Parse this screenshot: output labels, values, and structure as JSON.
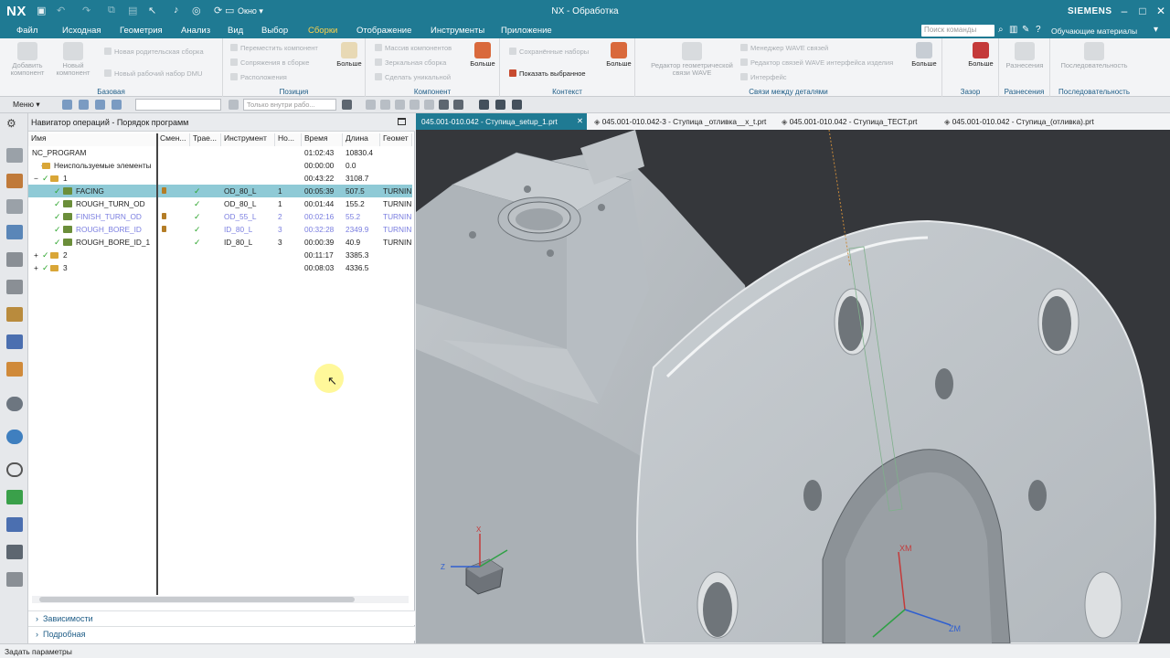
{
  "titlebar": {
    "logo": "NX",
    "window_label": "Окно ▾",
    "title": "NX - Обработка",
    "brand": "SIEMENS",
    "minimize": "–",
    "maximize": "□",
    "close": "✕"
  },
  "menubar": {
    "items": [
      "Файл",
      "Исходная",
      "Геометрия",
      "Анализ",
      "Вид",
      "Выбор",
      "Сборки",
      "Отображение",
      "Инструменты",
      "Приложение"
    ],
    "active": "Сборки",
    "search_placeholder": "Поиск команды",
    "learn": "Обучающие материалы"
  },
  "ribbon": {
    "base": {
      "label": "Базовая",
      "add_component": "Добавить компонент",
      "new_component": "Новый компонент",
      "new_parent": "Новая родительская сборка",
      "new_dmu": "Новый рабочий набор DMU"
    },
    "position": {
      "label": "Позиция",
      "move": "Переместить компонент",
      "constraints": "Сопряжения в сборке",
      "arrange": "Расположения",
      "more": "Больше"
    },
    "component": {
      "label": "Компонент",
      "array": "Массив компонентов",
      "mirror": "Зеркальная сборка",
      "unique": "Сделать уникальной",
      "more": "Больше"
    },
    "context": {
      "label": "Контекст",
      "saved_sets": "Сохранённые наборы",
      "show_selected": "Показать выбранное",
      "more": "Больше"
    },
    "links": {
      "label": "Связи между деталями",
      "editor": "Редактор геометрической связи WAVE",
      "wave_manager": "Менеджер WAVE связей",
      "wave_interface": "Редактор связей WAVE интерфейса изделия",
      "interface": "Интерфейс",
      "more": "Больше"
    },
    "gap": {
      "label": "Зазор",
      "more": "Больше"
    },
    "explode": {
      "label": "Разнесения",
      "button": "Разнесения"
    },
    "sequence": {
      "label": "Последовательность",
      "button": "Последовательность"
    }
  },
  "toolbar": {
    "menu": "Меню ▾",
    "filter_combo": "",
    "scope_combo": "Только внутри рабо..."
  },
  "navigator": {
    "title": "Навигатор операций - Порядок программ",
    "columns": [
      "Имя",
      "Смен...",
      "Трае...",
      "Инструмент",
      "Но...",
      "Время",
      "Длина",
      "Геомет"
    ],
    "rows": [
      {
        "name": "NC_PROGRAM",
        "tool": "",
        "num": "",
        "time": "01:02:43",
        "length": "10830.4",
        "geom": ""
      },
      {
        "name": "Неиспользуемые элементы",
        "tool": "",
        "num": "",
        "time": "00:00:00",
        "length": "0.0",
        "geom": ""
      },
      {
        "name": "1",
        "tool": "",
        "num": "",
        "time": "00:43:22",
        "length": "3108.7",
        "geom": ""
      },
      {
        "name": "FACING",
        "tool": "OD_80_L",
        "num": "1",
        "time": "00:05:39",
        "length": "507.5",
        "geom": "TURNIN"
      },
      {
        "name": "ROUGH_TURN_OD",
        "tool": "OD_80_L",
        "num": "1",
        "time": "00:01:44",
        "length": "155.2",
        "geom": "TURNIN"
      },
      {
        "name": "FINISH_TURN_OD",
        "tool": "OD_55_L",
        "num": "2",
        "time": "00:02:16",
        "length": "55.2",
        "geom": "TURNIN"
      },
      {
        "name": "ROUGH_BORE_ID",
        "tool": "ID_80_L",
        "num": "3",
        "time": "00:32:28",
        "length": "2349.9",
        "geom": "TURNIN"
      },
      {
        "name": "ROUGH_BORE_ID_1",
        "tool": "ID_80_L",
        "num": "3",
        "time": "00:00:39",
        "length": "40.9",
        "geom": "TURNIN"
      },
      {
        "name": "2",
        "tool": "",
        "num": "",
        "time": "00:11:17",
        "length": "3385.3",
        "geom": ""
      },
      {
        "name": "3",
        "tool": "",
        "num": "",
        "time": "00:08:03",
        "length": "4336.5",
        "geom": ""
      }
    ],
    "dependencies": "Зависимости",
    "details": "Подробная"
  },
  "tabs": [
    "045.001-010.042 - Ступица_setup_1.prt",
    "045.001-010.042-3 - Ступица _отливка__x_t.prt",
    "045.001-010.042 - Ступица_ТЕСТ.prt",
    "045.001-010.042 - Ступица_(отливка).prt"
  ],
  "viewport": {
    "xm_label": "XM",
    "zm_label": "ZM",
    "triad_x": "X",
    "triad_z": "Z"
  },
  "status": {
    "text": "Задать параметры"
  },
  "colors": {
    "accent": "#1f7a93",
    "selected_row": "#8fcad6",
    "menu_active": "#ffd24a"
  }
}
